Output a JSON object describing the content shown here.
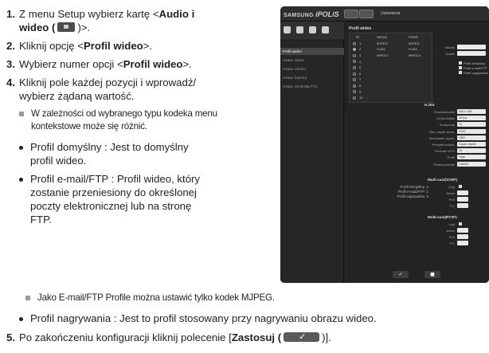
{
  "instructions": {
    "step1": {
      "num": "1.",
      "prefix": "Z menu Setup wybierz kartę <",
      "bold": "Audio i",
      "line2_bold": "wideo (",
      "line2_end": ")>."
    },
    "step2": {
      "num": "2.",
      "prefix": "Kliknij opcję <",
      "bold": "Profil wideo",
      "suffix": ">."
    },
    "step3": {
      "num": "3.",
      "prefix": "Wybierz numer opcji <",
      "bold": "Profil wideo",
      "suffix": ">."
    },
    "step4": {
      "num": "4.",
      "line1": "Kliknij pole każdej pozycji i wprowadź/",
      "line2": "wybierz żądaną wartość."
    },
    "note1": {
      "line1": "W zależności od wybranego typu kodeka menu",
      "line2": "kontekstowe może się różnić."
    },
    "bullet1": {
      "line1": "Profil domyślny : Jest to domyślny",
      "line2": "profil wideo."
    },
    "bullet2": {
      "line1": "Profil e-mail/FTP : Profil wideo, który",
      "line2": "zostanie przeniesiony do określonej",
      "line3": "poczty elektronicznej lub na stronę",
      "line4": "FTP."
    },
    "note2": {
      "text": "Jako E-mail/FTP Profile można ustawić tylko kodek MJPEG."
    },
    "bullet3": {
      "text": "Profil nagrywania : Jest to profil stosowany przy nagrywaniu obrazu wideo."
    },
    "step5": {
      "num": "5.",
      "prefix": "Po zakończeniu konfiguracji kliknij polecenie [",
      "bold": "Zastosuj (",
      "suffix": ")]."
    }
  },
  "screenshot": {
    "brand": "SAMSUNG",
    "brand_product": "iPOLiS",
    "top_label": "Ustawienia",
    "side_items": [
      "Profil wideo",
      "Ustaw. wideo",
      "Ustaw. obrazu",
      "Ustaw. kamery",
      "Ustaw. Zmieniłaj PTZ"
    ],
    "main_title": "Profil wideo",
    "table_headers": [
      "Nr",
      "Nazwa",
      "Kodek"
    ],
    "table_rows": [
      {
        "nr": "1",
        "name": "MJPEG",
        "codec": "MJPEG"
      },
      {
        "nr": "2",
        "name": "H.264",
        "codec": "H.264"
      },
      {
        "nr": "3",
        "name": "MPEG4",
        "codec": "MPEG-4"
      },
      {
        "nr": "4",
        "name": "",
        "codec": ""
      },
      {
        "nr": "5",
        "name": "",
        "codec": ""
      },
      {
        "nr": "6",
        "name": "",
        "codec": ""
      },
      {
        "nr": "7",
        "name": "",
        "codec": ""
      },
      {
        "nr": "8",
        "name": "",
        "codec": ""
      },
      {
        "nr": "9",
        "name": "",
        "codec": ""
      },
      {
        "nr": "10",
        "name": "",
        "codec": ""
      }
    ],
    "profile_defaults": [
      "Profil domyślny :2",
      "Profil e-mail/FTP :1",
      "Profil nagrywania :2"
    ],
    "right_fields": {
      "name_label": "Nazwa",
      "name_value": "H.264",
      "codec_label": "Kodek",
      "codec_value": "H.264",
      "checks": [
        "Profil domyślny",
        "Profil e-mail/FTP",
        "Profil nagrywania"
      ],
      "section": "H.264",
      "rows": [
        {
          "label": "Rozdzielczość",
          "value": "640 x 480"
        },
        {
          "label": "Liczba klatek",
          "value": "30 fps"
        },
        {
          "label": "Kompresja",
          "value": "10"
        },
        {
          "label": "Max. szybk. trans.",
          "value": "1200"
        },
        {
          "label": "Sterowanie szybk.",
          "value": "CBR"
        },
        {
          "label": "Priorytet kodow.",
          "value": "Częst. klatek"
        },
        {
          "label": "Rozmiar GOV",
          "value": "15"
        },
        {
          "label": "Profil",
          "value": "High"
        },
        {
          "label": "Rodzaj entropii",
          "value": "CABAC"
        }
      ],
      "rtsp_section": "Multi-cast(SVNP)",
      "rtsp_rows": [
        "Użyj",
        "Adres",
        "Port",
        "TTL"
      ],
      "rtp_section": "Multi-cast(RTSP)",
      "rtp_rows": [
        "Użyj",
        "Adres",
        "Port",
        "TTL"
      ]
    }
  }
}
